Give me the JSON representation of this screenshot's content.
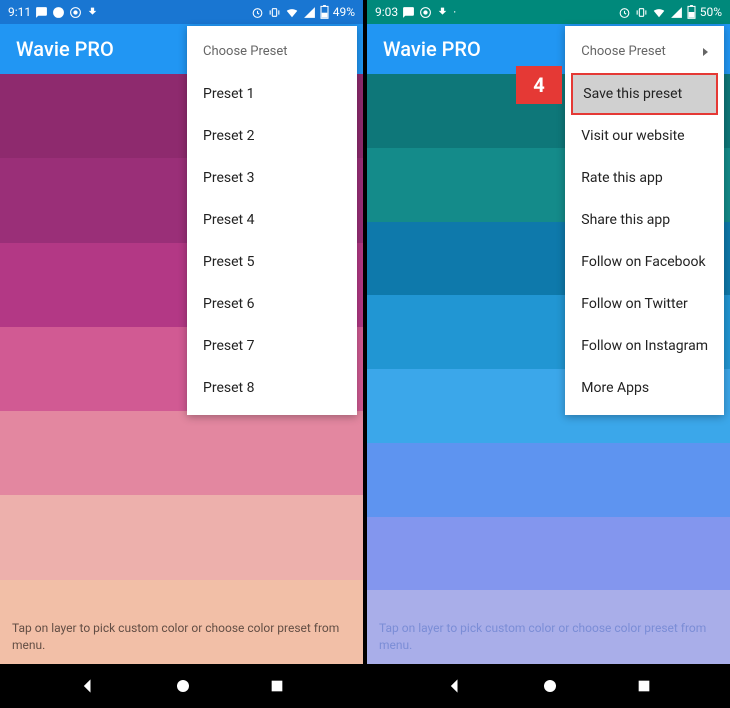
{
  "left": {
    "status": {
      "time": "9:11",
      "battery": "49%"
    },
    "app_title": "Wavie PRO",
    "menu_header": "Choose Preset",
    "menu_items": [
      "Preset 1",
      "Preset 2",
      "Preset 3",
      "Preset 4",
      "Preset 5",
      "Preset 6",
      "Preset 7",
      "Preset 8"
    ],
    "stripes": [
      "#8e2a6e",
      "#9a2f78",
      "#b33885",
      "#d15a93",
      "#e387a0",
      "#edb0ac",
      "#f2bfa7"
    ],
    "hint": "Tap on layer to pick custom color or choose color preset from menu."
  },
  "right": {
    "status": {
      "time": "9:03",
      "battery": "50%"
    },
    "app_title": "Wavie PRO",
    "menu_header": "Choose Preset",
    "menu_items": [
      "Save this preset",
      "Visit our website",
      "Rate this app",
      "Share this app",
      "Follow on Facebook",
      "Follow on Twitter",
      "Follow on Instagram",
      "More Apps"
    ],
    "callout_number": "4",
    "stripes": [
      "#0e7779",
      "#148b8a",
      "#0e79ab",
      "#2196d3",
      "#3ba7ea",
      "#5e94f0",
      "#8396ee",
      "#a9aee9"
    ],
    "hint": "Tap on layer to pick custom color or choose color preset from menu."
  }
}
